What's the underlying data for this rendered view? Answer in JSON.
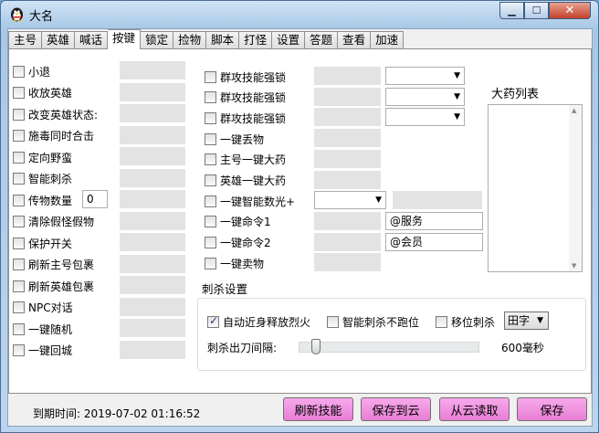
{
  "window": {
    "title": "大名",
    "min_glyph": "▁",
    "max_glyph": "☐",
    "close_glyph": "✕"
  },
  "tabs": [
    "主号",
    "英雄",
    "喊话",
    "按键",
    "锁定",
    "捡物",
    "脚本",
    "打怪",
    "设置",
    "答题",
    "查看",
    "加速"
  ],
  "active_tab": "按键",
  "left_options": [
    {
      "label": "小退"
    },
    {
      "label": "收放英雄"
    },
    {
      "label": "改变英雄状态:"
    },
    {
      "label": "施毒同时合击"
    },
    {
      "label": "定向野蛮"
    },
    {
      "label": "智能刺杀"
    },
    {
      "label": "传物数量",
      "value": "0"
    },
    {
      "label": "清除假怪假物"
    },
    {
      "label": "保护开关"
    },
    {
      "label": "刷新主号包裹"
    },
    {
      "label": "刷新英雄包裹"
    },
    {
      "label": "NPC对话"
    },
    {
      "label": "一键随机"
    },
    {
      "label": "一键回城"
    }
  ],
  "mid_options": [
    {
      "label": "群攻技能强锁"
    },
    {
      "label": "群攻技能强锁"
    },
    {
      "label": "群攻技能强锁"
    },
    {
      "label": "一键丢物"
    },
    {
      "label": "主号一键大药"
    },
    {
      "label": "英雄一键大药"
    },
    {
      "label": "一键智能数光+"
    },
    {
      "label": "一键命令1",
      "text": "@服务"
    },
    {
      "label": "一键命令2",
      "text": "@会员"
    },
    {
      "label": "一键卖物"
    }
  ],
  "potion_list": {
    "title": "大药列表"
  },
  "scroll_icons": {
    "up": "▲",
    "down": "▼",
    "combo": "▼"
  },
  "stab_settings": {
    "title": "刺杀设置",
    "auto_release": {
      "label": "自动近身释放烈火",
      "checked": true
    },
    "no_run": {
      "label": "智能刺杀不跑位",
      "checked": false
    },
    "move_stab": {
      "label": "移位刺杀",
      "checked": false
    },
    "mode": "田字",
    "interval_label": "刺杀出刀间隔:",
    "interval_value": "600毫秒",
    "interval_ms": 600
  },
  "status": {
    "expiry": "到期时间: 2019-07-02 01:16:52"
  },
  "buttons": {
    "refresh": "刷新技能",
    "save_cloud": "保存到云",
    "load_cloud": "从云读取",
    "save": "保存"
  },
  "colors": {
    "button_pink": "#eea0e3",
    "input_gray": "#e3e3e3"
  }
}
